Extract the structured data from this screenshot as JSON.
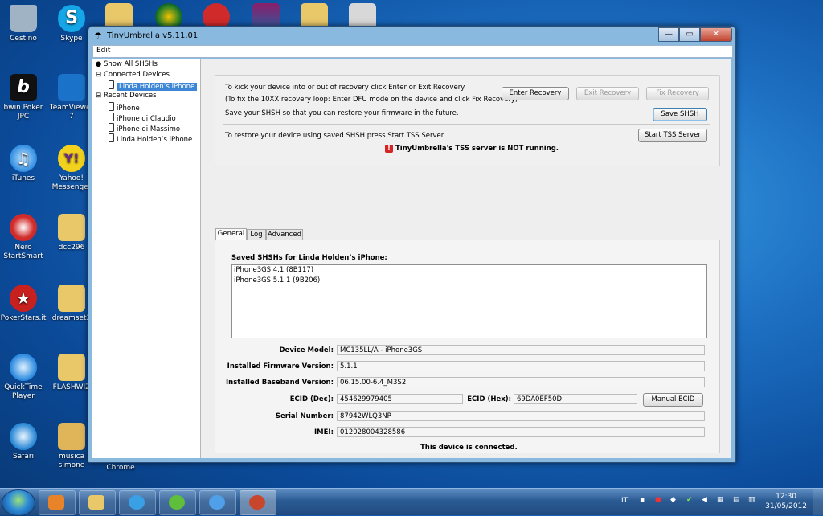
{
  "desktop": {
    "icons": [
      {
        "label": "Cestino",
        "color": "#9fb3c5"
      },
      {
        "label": "Skype",
        "color": "#14a6e6"
      },
      {
        "label": "bwin Poker JPC",
        "color": "#111111"
      },
      {
        "label": "TeamViewer 7",
        "color": "#1b73c9"
      },
      {
        "label": "iTunes",
        "color": "#2d8be0"
      },
      {
        "label": "Yahoo! Messenger",
        "color": "#6c2a8f"
      },
      {
        "label": "Nero StartSmart",
        "color": "#d12a2a"
      },
      {
        "label": "dcc296",
        "color": "#e9c86a"
      },
      {
        "label": "PokerStars.it",
        "color": "#c8201e"
      },
      {
        "label": "dreamset2",
        "color": "#e9c86a"
      },
      {
        "label": "QuickTime Player",
        "color": "#2d8be0"
      },
      {
        "label": "FLASHWIZ",
        "color": "#e9c86a"
      },
      {
        "label": "Safari",
        "color": "#2a88d6"
      },
      {
        "label": "musica simone",
        "color": "#e0b55a"
      },
      {
        "label": "Chrome",
        "color": "#e8e8e8"
      }
    ]
  },
  "window": {
    "title": "TinyUmbrella v5.11.01",
    "controls": {
      "minimize": "—",
      "maximize": "▭",
      "close": "✕"
    },
    "menu": [
      "Edit"
    ]
  },
  "tree": {
    "show_all": "Show All SHSHs",
    "connected_header": "Connected Devices",
    "connected": [
      "Linda Holden’s iPhone"
    ],
    "recent_header": "Recent Devices",
    "recent": [
      "iPhone",
      "iPhone di Claudio",
      "iPhone di Massimo",
      "Linda Holden’s iPhone"
    ]
  },
  "top_panel": {
    "line1": "To kick your device into or out of recovery click Enter or Exit Recovery",
    "line2": "(To fix the 10XX recovery loop: Enter DFU mode on the device and click Fix Recovery)",
    "line3": "Save your SHSH so that you can restore your firmware in the future.",
    "line4": "To restore your device using saved SHSH press Start TSS Server",
    "tss_status": "TinyUmbrella's TSS server is NOT running.",
    "buttons": {
      "enter": "Enter Recovery",
      "exit": "Exit Recovery",
      "fix": "Fix Recovery",
      "save": "Save SHSH",
      "start_tss": "Start TSS Server"
    }
  },
  "tabs": [
    "General",
    "Log",
    "Advanced"
  ],
  "general": {
    "saved_title": "Saved SHSHs for Linda Holden’s iPhone:",
    "saved_list": [
      "iPhone3GS 4.1 (8B117)",
      "iPhone3GS 5.1.1 (9B206)"
    ],
    "labels": {
      "model": "Device Model:",
      "firmware": "Installed Firmware Version:",
      "baseband": "Installed Baseband Version:",
      "ecid_dec": "ECID (Dec):",
      "ecid_hex": "ECID (Hex):",
      "serial": "Serial Number:",
      "imei": "IMEI:"
    },
    "values": {
      "model": "MC135LL/A - iPhone3GS",
      "firmware": "5.1.1",
      "baseband": "06.15.00-6.4_M3S2",
      "ecid_dec": "454629979405",
      "ecid_hex": "69DA0EF50D",
      "serial": "87942WLQ3NP",
      "imei": "012028004328586"
    },
    "manual_ecid": "Manual ECID",
    "status": "This device is connected."
  },
  "taskbar": {
    "lang": "IT",
    "time": "12:30",
    "date": "31/05/2012",
    "buttons": [
      {
        "name": "media-player",
        "color": "#e8832a"
      },
      {
        "name": "explorer",
        "color": "#e9c86a"
      },
      {
        "name": "internet-explorer",
        "color": "#3aa0e6"
      },
      {
        "name": "messenger",
        "color": "#5fbf3a"
      },
      {
        "name": "itunes",
        "color": "#4fa0e8"
      },
      {
        "name": "tinyumbrella",
        "color": "#c7462c"
      }
    ]
  }
}
